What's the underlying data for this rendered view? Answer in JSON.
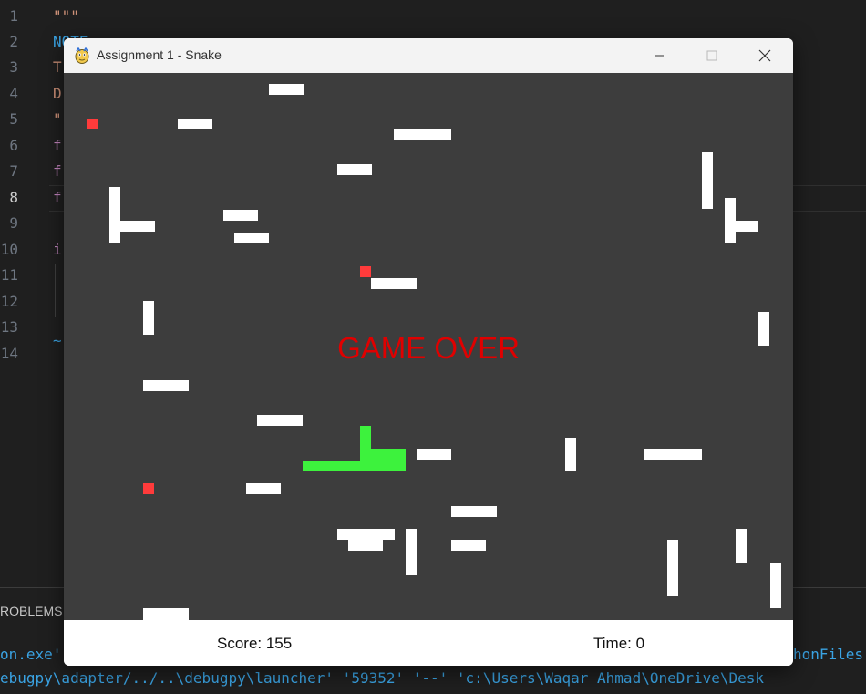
{
  "editor": {
    "line_numbers": [
      "1",
      "2",
      "3",
      "4",
      "5",
      "6",
      "7",
      "8",
      "9",
      "10",
      "11",
      "12",
      "13",
      "14"
    ],
    "code_fragments": [
      "\"\"\"",
      "NOTE",
      "T",
      "D",
      "\"",
      "f",
      "f",
      "f",
      "i",
      "~"
    ]
  },
  "panel": {
    "tab_label": "ROBLEMS",
    "terminal_lines": [
      {
        "left": "on.exe'",
        "right": "honFiles"
      },
      {
        "text": "ebugpy\\adapter/../..\\debugpy\\launcher' '59352' '--' 'c:\\Users\\Waqar Ahmad\\OneDrive\\Desk"
      }
    ]
  },
  "window": {
    "title": "Assignment 1 - Snake",
    "buttons": {
      "minimize": "minimize",
      "maximize": "maximize",
      "close": "close"
    }
  },
  "game": {
    "message": "GAME OVER",
    "score_label": "Score: 155",
    "time_label": "Time: 0",
    "colors": {
      "background": "#3d3d3d",
      "walls": "#ffffff",
      "food": "#ff3b3b",
      "snake": "#3df23d",
      "message": "#e00000"
    }
  }
}
